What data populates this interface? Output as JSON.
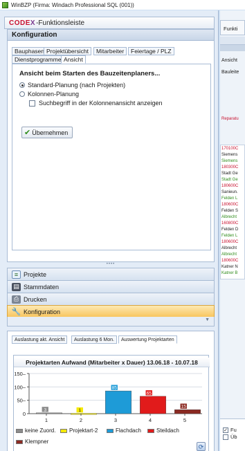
{
  "window": {
    "title": "WinBZP (Firma: Windach Professional SQL  (001))"
  },
  "toolbar_header": {
    "logo_codex": "CODE",
    "logo_x": "X",
    "label": "-Funktionsleiste"
  },
  "config_panel": {
    "title": "Konfiguration",
    "tabs": [
      {
        "label": "Bauphasen"
      },
      {
        "label": "Projektübersicht"
      },
      {
        "label": "Mitarbeiter"
      },
      {
        "label": "Feiertage / PLZ"
      },
      {
        "label": "Dienstprogramme"
      },
      {
        "label": "Ansicht",
        "active": true
      }
    ],
    "section_title": "Ansicht beim Starten des Bauzeitenplaners...",
    "options": [
      {
        "label": "Standard-Planung (nach Projekten)",
        "selected": true
      },
      {
        "label": "Kolonnen-Planung",
        "selected": false
      }
    ],
    "checkbox": {
      "label": "Suchbegriff in der Kolonnenansicht anzeigen",
      "checked": false
    },
    "apply_button": "Übernehmen"
  },
  "nav": {
    "items": [
      {
        "label": "Projekte",
        "icon": "projects-icon"
      },
      {
        "label": "Stammdaten",
        "icon": "database-icon"
      },
      {
        "label": "Drucken",
        "icon": "printer-icon"
      },
      {
        "label": "Konfiguration",
        "icon": "wrench-icon",
        "active": true
      }
    ],
    "chevron": "▼"
  },
  "lower_panel": {
    "tabs": [
      {
        "label": "Auslastung akt. Ansicht"
      },
      {
        "label": "Auslastung 6 Mon."
      },
      {
        "label": "Auswertung Projektarten",
        "active": true
      }
    ]
  },
  "chart_data": {
    "type": "bar",
    "title": "Projektarten Aufwand (Mitarbeiter x Dauer) 13.06.18 - 10.07.18",
    "categories": [
      "1",
      "2",
      "3",
      "4",
      "5"
    ],
    "ylim": [
      0,
      150
    ],
    "yticks": [
      0,
      50,
      100,
      150
    ],
    "grid": true,
    "legend_position": "bottom",
    "bars": [
      {
        "category": "1",
        "series": "keine Zuord.",
        "value": 3,
        "label": "3",
        "color": "#8c8c8c"
      },
      {
        "category": "2",
        "series": "Projektart-2",
        "value": 1,
        "label": "1",
        "color": "#f5e900"
      },
      {
        "category": "3",
        "series": "Flachdach",
        "value": 85,
        "label": "85",
        "color": "#1e9bd7"
      },
      {
        "category": "4",
        "series": "Steildach",
        "value": 65,
        "label": "65",
        "color": "#e11b1b"
      },
      {
        "category": "5",
        "series": "Klempner",
        "value": 15,
        "label": "15",
        "color": "#8b2a22"
      }
    ],
    "series": [
      {
        "name": "keine Zuord.",
        "color": "#8c8c8c"
      },
      {
        "name": "Projektart-2",
        "color": "#f5e900"
      },
      {
        "name": "Flachdach",
        "color": "#1e9bd7"
      },
      {
        "name": "Steildach",
        "color": "#e11b1b"
      },
      {
        "name": "Klempner",
        "color": "#8b2a22"
      }
    ]
  },
  "right_pane": {
    "tab_label": "Funkti",
    "labels": [
      "Ansicht",
      "Bauleite"
    ],
    "red_note": "Reparatu",
    "list_items": [
      {
        "text": "170100C",
        "color": "#c8102e"
      },
      {
        "text": "Siemens",
        "color": "#1a1a1a"
      },
      {
        "text": "Siemens",
        "color": "#2e8b1a"
      },
      {
        "text": "180300C",
        "color": "#c8102e"
      },
      {
        "text": "Stadt Ge",
        "color": "#1a1a1a"
      },
      {
        "text": "Stadt Ge",
        "color": "#2e8b1a"
      },
      {
        "text": "180600C",
        "color": "#c8102e"
      },
      {
        "text": "Sanieun.",
        "color": "#1a1a1a"
      },
      {
        "text": "Felden L",
        "color": "#2e8b1a"
      },
      {
        "text": "180600C",
        "color": "#c8102e"
      },
      {
        "text": "Felden S",
        "color": "#1a1a1a"
      },
      {
        "text": "Albrecht",
        "color": "#2e8b1a"
      },
      {
        "text": "160800C",
        "color": "#c8102e"
      },
      {
        "text": "Felden D",
        "color": "#1a1a1a"
      },
      {
        "text": "Felden L",
        "color": "#2e8b1a"
      },
      {
        "text": "180600C",
        "color": "#c8102e"
      },
      {
        "text": "Albrecht",
        "color": "#1a1a1a"
      },
      {
        "text": "Albrecht",
        "color": "#2e8b1a"
      },
      {
        "text": "180600C",
        "color": "#c8102e"
      },
      {
        "text": "Katner N",
        "color": "#1a1a1a"
      },
      {
        "text": "Katner B",
        "color": "#2e8b1a"
      }
    ],
    "checkboxes": [
      {
        "label": "Fu",
        "checked": true
      },
      {
        "label": "Üb",
        "checked": false
      }
    ]
  }
}
